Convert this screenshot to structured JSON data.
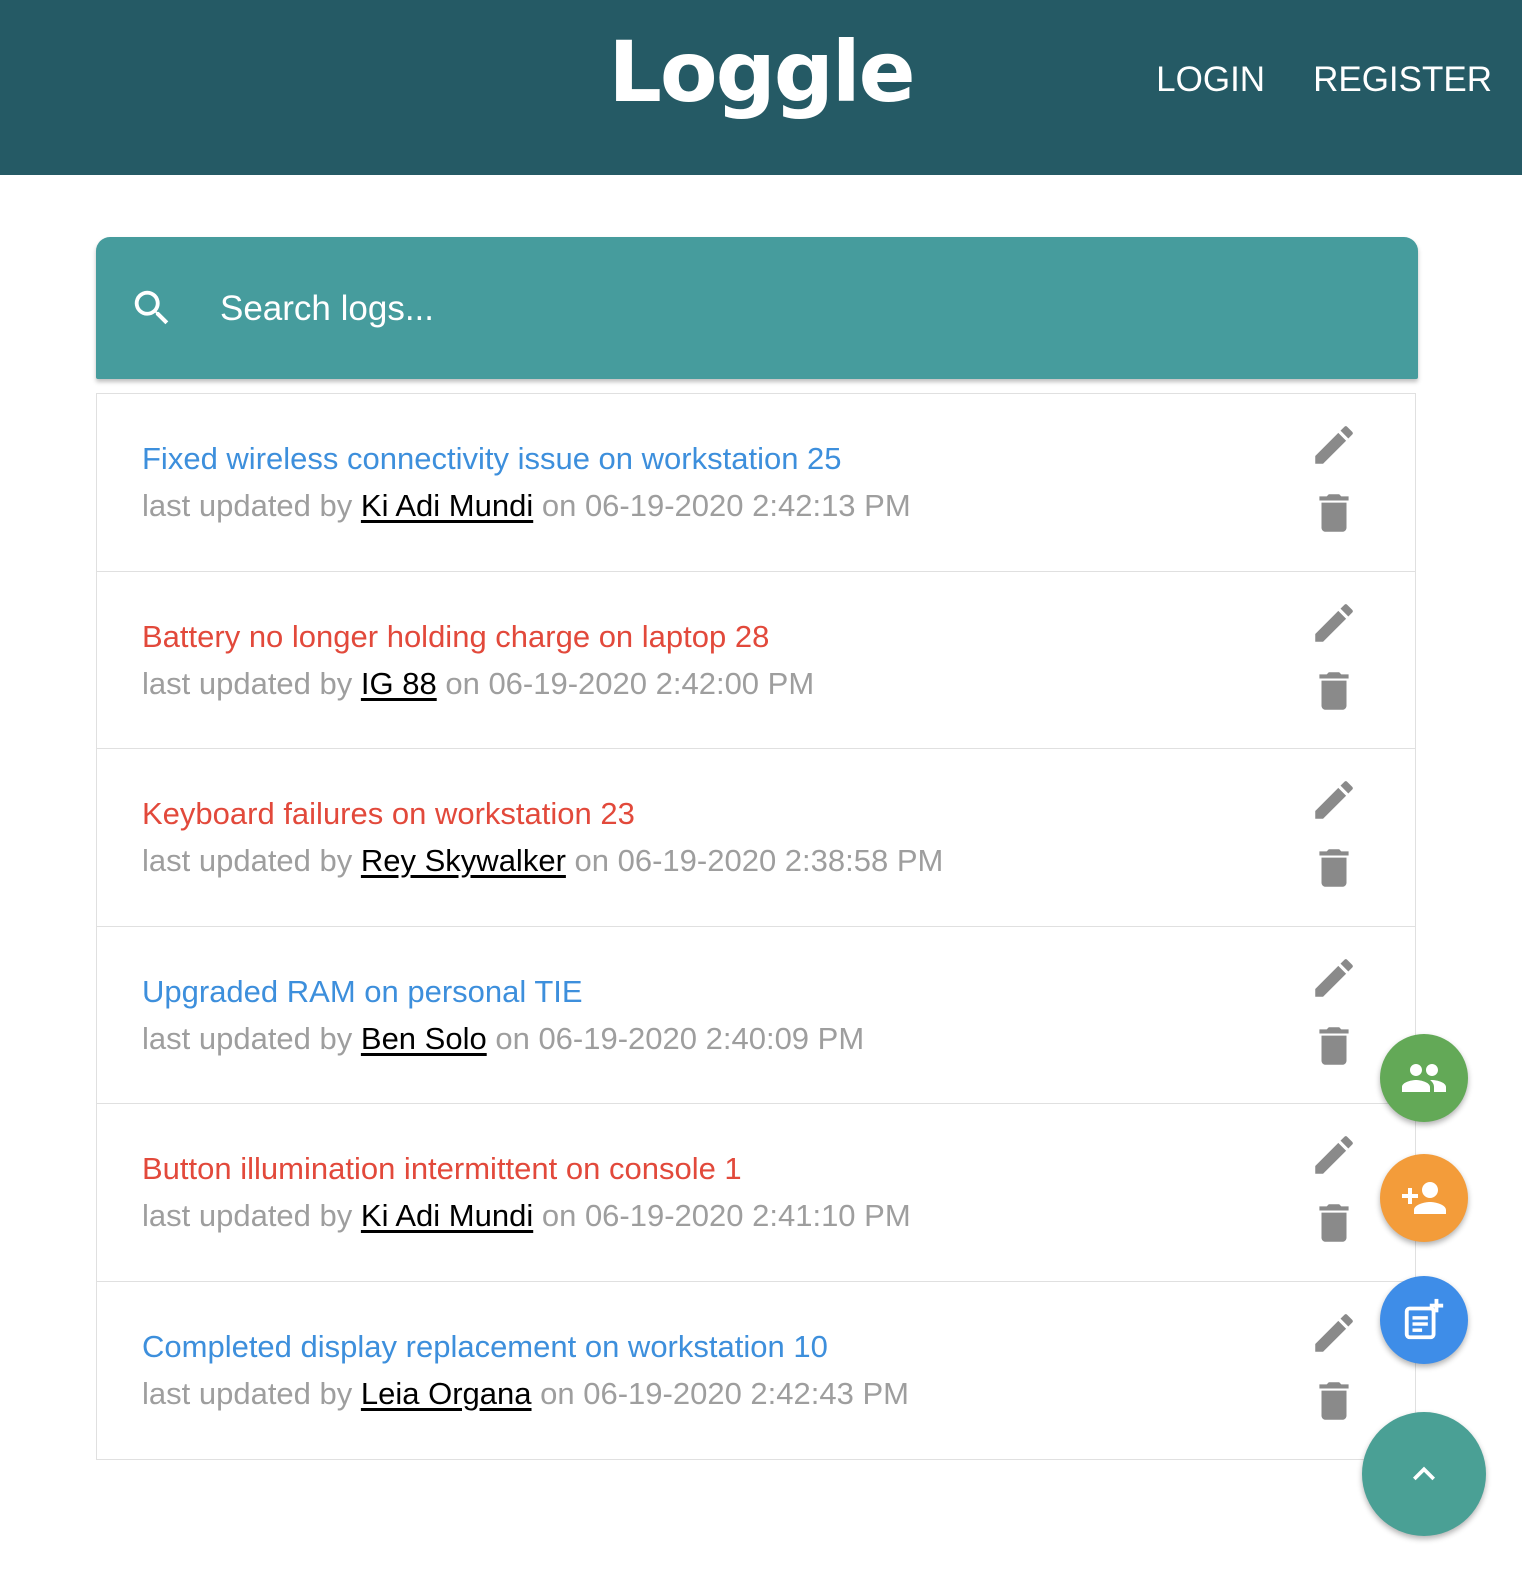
{
  "navbar": {
    "brand": "Loggle",
    "links": [
      "LOGIN",
      "REGISTER"
    ]
  },
  "search": {
    "placeholder": "Search logs..."
  },
  "logs": [
    {
      "message": "Fixed wireless connectivity issue on workstation 25",
      "attention": false,
      "prefix": "last updated by",
      "tech": "Ki Adi Mundi",
      "date": "on 06-19-2020 2:42:13 PM"
    },
    {
      "message": "Battery no longer holding charge on laptop 28",
      "attention": true,
      "prefix": "last updated by",
      "tech": "IG 88",
      "date": "on 06-19-2020 2:42:00 PM"
    },
    {
      "message": "Keyboard failures on workstation 23",
      "attention": true,
      "prefix": "last updated by",
      "tech": "Rey Skywalker",
      "date": "on 06-19-2020 2:38:58 PM"
    },
    {
      "message": "Upgraded RAM on personal TIE",
      "attention": false,
      "prefix": "last updated by",
      "tech": "Ben Solo",
      "date": "on 06-19-2020 2:40:09 PM"
    },
    {
      "message": "Button illumination intermittent on console 1",
      "attention": true,
      "prefix": "last updated by",
      "tech": "Ki Adi Mundi",
      "date": "on 06-19-2020 2:41:10 PM"
    },
    {
      "message": "Completed display replacement on workstation 10",
      "attention": false,
      "prefix": "last updated by",
      "tech": "Leia Organa",
      "date": "on 06-19-2020 2:42:43 PM"
    }
  ],
  "colors": {
    "navbar": "#255a65",
    "search_bar": "#469c9d",
    "normal_log": "#3d8fdc",
    "attention_log": "#e2493b",
    "fab_users": "#63a957",
    "fab_add_tech": "#f39c3a",
    "fab_add_log": "#3e8de8",
    "fab_main": "#4aa095"
  },
  "icons": {
    "search": "search-icon",
    "edit": "pencil-icon",
    "delete": "trash-icon",
    "users": "people-icon",
    "add_tech": "person-add-icon",
    "add_log": "note-add-icon",
    "expand": "chevron-up-icon"
  }
}
